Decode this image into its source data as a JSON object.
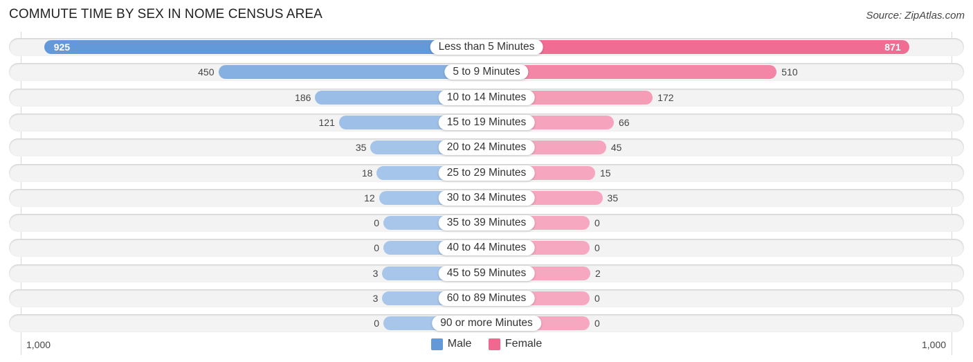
{
  "header": {
    "title": "COMMUTE TIME BY SEX IN NOME CENSUS AREA",
    "source": "Source: ZipAtlas.com"
  },
  "colors": {
    "male_strong": "#6499d9",
    "male_light": "#a7c6ea",
    "female_strong": "#f06890",
    "female_light": "#f6a8c0"
  },
  "chart_data": {
    "type": "bar",
    "orientation": "horizontal-diverging",
    "title": "COMMUTE TIME BY SEX IN NOME CENSUS AREA",
    "categories": [
      "Less than 5 Minutes",
      "5 to 9 Minutes",
      "10 to 14 Minutes",
      "15 to 19 Minutes",
      "20 to 24 Minutes",
      "25 to 29 Minutes",
      "30 to 34 Minutes",
      "35 to 39 Minutes",
      "40 to 44 Minutes",
      "45 to 59 Minutes",
      "60 to 89 Minutes",
      "90 or more Minutes"
    ],
    "series": [
      {
        "name": "Male",
        "values": [
          925,
          450,
          186,
          121,
          35,
          18,
          12,
          0,
          0,
          3,
          3,
          0
        ]
      },
      {
        "name": "Female",
        "values": [
          871,
          510,
          172,
          66,
          45,
          15,
          35,
          0,
          0,
          2,
          0,
          0
        ]
      }
    ],
    "xlim": [
      -1000,
      1000
    ],
    "tick_labels": {
      "left": "1,000",
      "right": "1,000"
    },
    "legend": {
      "position": "bottom-center",
      "entries": [
        "Male",
        "Female"
      ]
    },
    "grid": false
  }
}
